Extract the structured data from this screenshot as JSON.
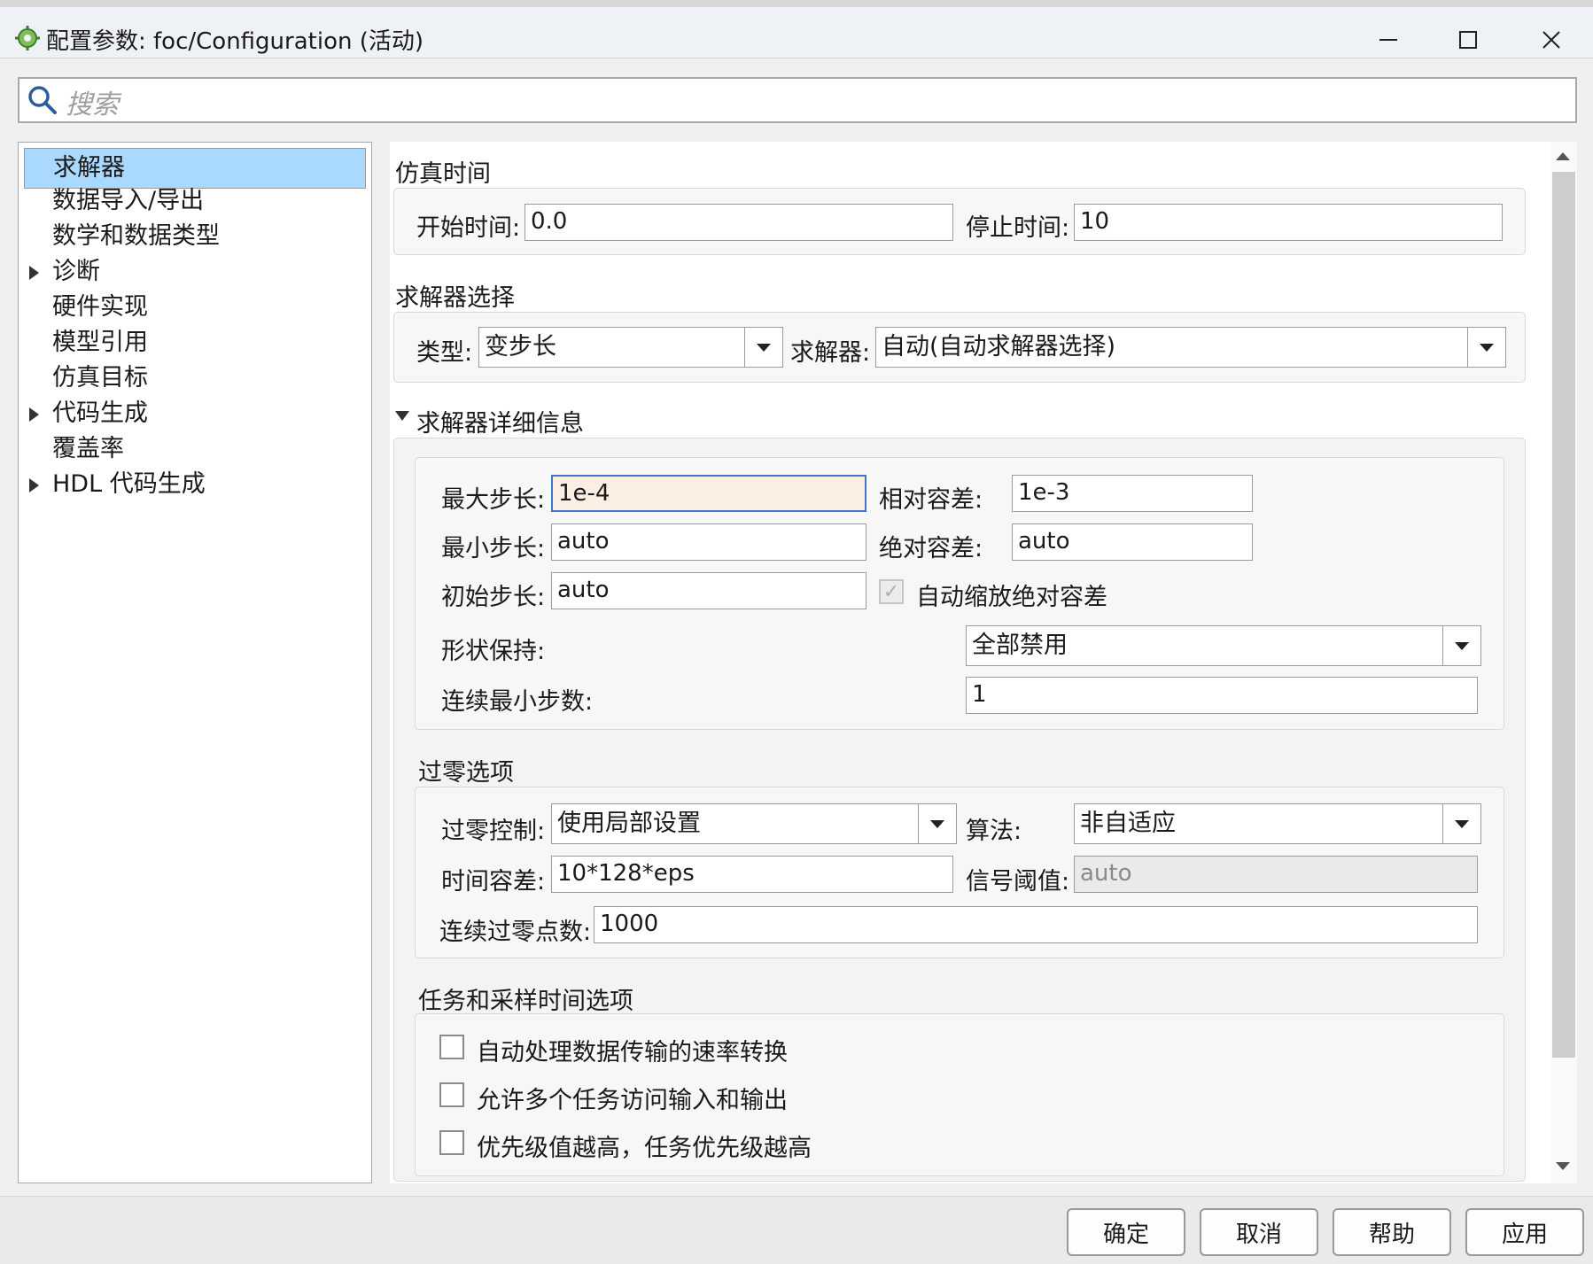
{
  "window": {
    "title": "配置参数: foc/Configuration (活动)"
  },
  "search": {
    "placeholder": "搜索"
  },
  "tree": {
    "items": [
      {
        "label": "求解器",
        "expandable": false,
        "selected": true
      },
      {
        "label": "数据导入/导出",
        "expandable": false,
        "selected": false
      },
      {
        "label": "数学和数据类型",
        "expandable": false,
        "selected": false
      },
      {
        "label": "诊断",
        "expandable": true,
        "selected": false
      },
      {
        "label": "硬件实现",
        "expandable": false,
        "selected": false
      },
      {
        "label": "模型引用",
        "expandable": false,
        "selected": false
      },
      {
        "label": "仿真目标",
        "expandable": false,
        "selected": false
      },
      {
        "label": "代码生成",
        "expandable": true,
        "selected": false
      },
      {
        "label": "覆盖率",
        "expandable": false,
        "selected": false
      },
      {
        "label": "HDL 代码生成",
        "expandable": true,
        "selected": false
      }
    ]
  },
  "sim_time": {
    "title": "仿真时间",
    "start_label": "开始时间:",
    "start_value": "0.0",
    "stop_label": "停止时间:",
    "stop_value": "10"
  },
  "solver_select": {
    "title": "求解器选择",
    "type_label": "类型:",
    "type_value": "变步长",
    "solver_label": "求解器:",
    "solver_value": "自动(自动求解器选择)"
  },
  "solver_details": {
    "title": "求解器详细信息",
    "max_step_label": "最大步长:",
    "max_step_value": "1e-4",
    "rel_tol_label": "相对容差:",
    "rel_tol_value": "1e-3",
    "min_step_label": "最小步长:",
    "min_step_value": "auto",
    "abs_tol_label": "绝对容差:",
    "abs_tol_value": "auto",
    "init_step_label": "初始步长:",
    "init_step_value": "auto",
    "auto_scale_label": "自动缩放绝对容差",
    "auto_scale_checked": true,
    "shape_label": "形状保持:",
    "shape_value": "全部禁用",
    "consec_min_label": "连续最小步数:",
    "consec_min_value": "1"
  },
  "zero_crossing": {
    "title": "过零选项",
    "control_label": "过零控制:",
    "control_value": "使用局部设置",
    "algo_label": "算法:",
    "algo_value": "非自适应",
    "time_tol_label": "时间容差:",
    "time_tol_value": "10*128*eps",
    "signal_thr_label": "信号阈值:",
    "signal_thr_value": "auto",
    "consec_label": "连续过零点数:",
    "consec_value": "1000"
  },
  "tasking": {
    "title": "任务和采样时间选项",
    "items": [
      {
        "label": "自动处理数据传输的速率转换",
        "checked": false
      },
      {
        "label": "允许多个任务访问输入和输出",
        "checked": false
      },
      {
        "label": "优先级值越高，任务优先级越高",
        "checked": false
      }
    ]
  },
  "buttons": {
    "ok": "确定",
    "cancel": "取消",
    "help": "帮助",
    "apply": "应用"
  },
  "colors": {
    "selection": "#aad9ff",
    "focus_border": "#3c78c8",
    "focus_bg": "#fbeee3"
  }
}
